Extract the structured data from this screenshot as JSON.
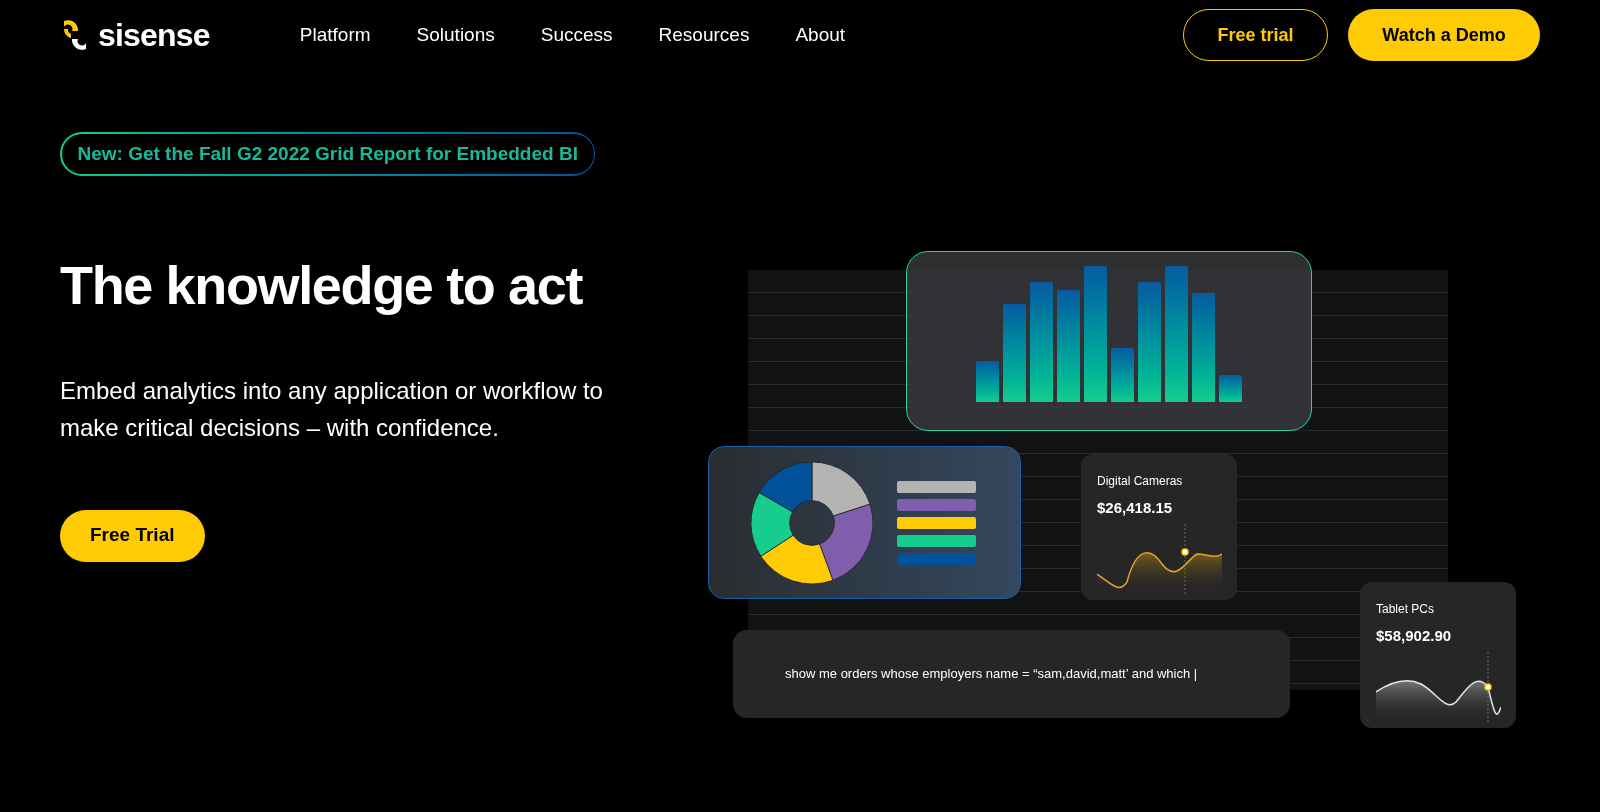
{
  "logo": {
    "text": "sisense"
  },
  "nav": [
    {
      "label": "Platform"
    },
    {
      "label": "Solutions"
    },
    {
      "label": "Success"
    },
    {
      "label": "Resources"
    },
    {
      "label": "About"
    }
  ],
  "actions": [
    {
      "label": "Free trial",
      "kind": "outline"
    },
    {
      "label": "Watch a Demo",
      "kind": "filled"
    }
  ],
  "announcement": "New: Get the Fall G2 2022 Grid Report for Embedded BI",
  "hero": {
    "title": "The knowledge to act",
    "subtitle": "Embed analytics into any application or workflow to make critical decisions – with confidence.",
    "cta": "Free Trial"
  },
  "widgets": [
    {
      "title": "Digital Cameras",
      "value": "$26,418.15",
      "kind": "gold"
    },
    {
      "title": "Tablet PCs",
      "value": "$58,902.90",
      "kind": "silver"
    }
  ],
  "query": "show me orders whose employers name = “sam,david,matt’ and which |"
}
